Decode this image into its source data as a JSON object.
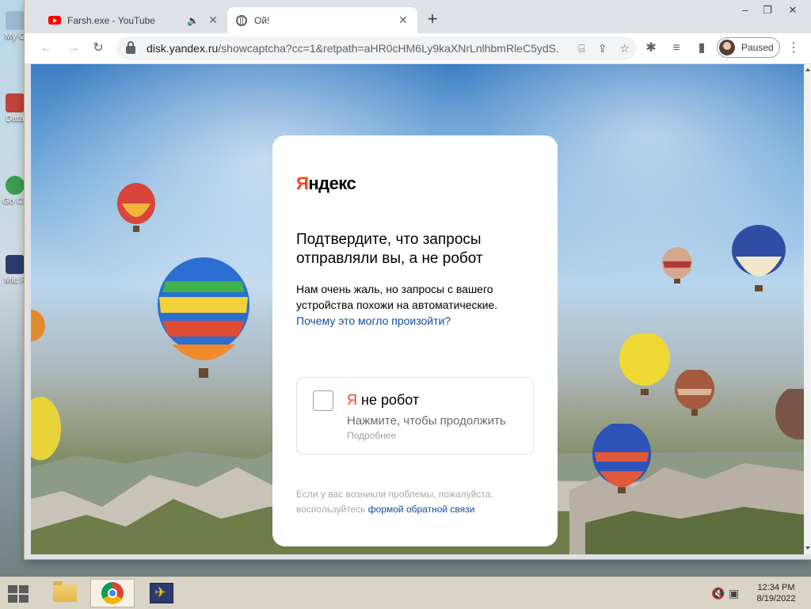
{
  "desktop": {
    "icons": [
      {
        "label": "My C"
      },
      {
        "label": "Data"
      },
      {
        "label": "Go Ch"
      },
      {
        "label": "Mic F"
      }
    ]
  },
  "browser": {
    "tabs": [
      {
        "title": "Farsh.exe - YouTube",
        "favicon": "youtube-icon",
        "audio": "🔈"
      },
      {
        "title": "Ой!",
        "favicon": "globe-icon"
      }
    ],
    "new_tab": "+",
    "window_controls": [
      "–",
      "❐",
      "✕"
    ],
    "url_host": "disk.yandex.ru",
    "url_path": "/showcaptcha?cc=1&retpath=aHR0cHM6Ly9kaXNrLnlhbmRleC5ydS...",
    "profile_status": "Paused"
  },
  "captcha": {
    "logo_first": "Я",
    "logo_rest": "ндекс",
    "heading": "Подтвердите, что запросы отправляли вы, а не робот",
    "description": "Нам очень жаль, но запросы с вашего устройства похожи на автоматические. ",
    "why_link": "Почему это могло произойти?",
    "checkbox_label_first": "Я",
    "checkbox_label_rest": " не робот",
    "checkbox_hint": "Нажмите, чтобы продолжить",
    "more_link": "Подробнее",
    "footer_text": "Если у вас возникли проблемы, пожалуйста, воспользуйтесь ",
    "footer_link": "формой обратной связи"
  },
  "taskbar": {
    "time": "12:34 PM",
    "date": "8/19/2022"
  },
  "colors": {
    "yandex_red": "#fc3f1d",
    "link_blue": "#0f4c9c",
    "window_border": "#c9a46a"
  }
}
